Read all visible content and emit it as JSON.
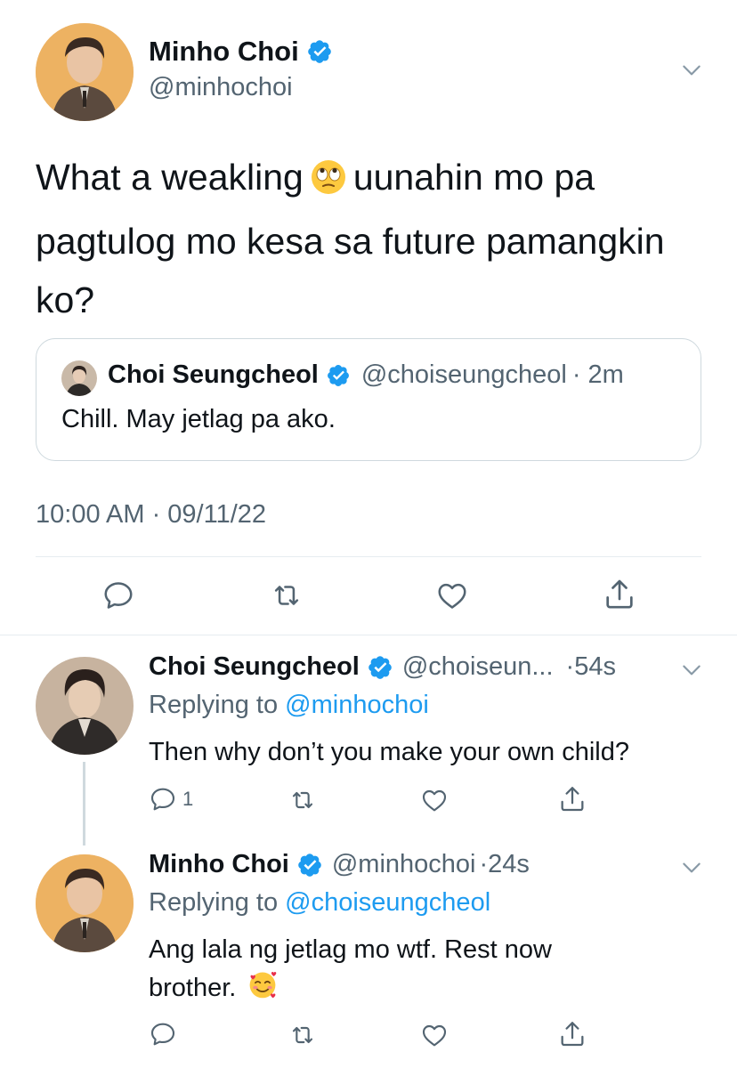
{
  "main_tweet": {
    "name": "Minho Choi",
    "handle": "@minhochoi",
    "text_part1": "What a weakling",
    "emoji": "face-with-rolling-eyes",
    "text_part2": "uunahin mo pa pagtulog mo kesa sa future pamangkin ko?",
    "timestamp": "10:00 AM · 09/11/22"
  },
  "quoted_tweet": {
    "name": "Choi Seungcheol",
    "handle": "@choiseungcheol",
    "time": "· 2m",
    "text": "Chill. May jetlag pa ako."
  },
  "replies": [
    {
      "name": "Choi Seungcheol",
      "handle": "@choiseun...",
      "time": "·54s",
      "replying_label": "Replying to",
      "replying_to": "@minhochoi",
      "text": "Then why don’t you make your own child?",
      "reply_count": "1"
    },
    {
      "name": "Minho Choi",
      "handle": "@minhochoi",
      "time": "·24s",
      "replying_label": "Replying to",
      "replying_to": "@choiseungcheol",
      "text": "Ang lala ng jetlag mo wtf. Rest now brother.",
      "emoji": "smiling-face-with-hearts"
    }
  ],
  "colors": {
    "accent": "#1d9bf0",
    "muted": "#536471",
    "border": "#cfd9de"
  }
}
